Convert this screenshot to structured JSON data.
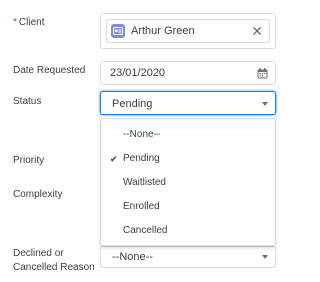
{
  "form": {
    "client": {
      "required_marker": "*",
      "label": "Client",
      "value": "Arthur Green",
      "icon": "contact-card-icon",
      "clear_glyph": "✕"
    },
    "date_requested": {
      "label": "Date Requested",
      "value": "23/01/2020",
      "icon": "calendar-icon"
    },
    "status": {
      "label": "Status",
      "value": "Pending",
      "options": [
        {
          "label": "--None--",
          "selected": false
        },
        {
          "label": "Pending",
          "selected": true
        },
        {
          "label": "Waitlisted",
          "selected": false
        },
        {
          "label": "Enrolled",
          "selected": false
        },
        {
          "label": "Cancelled",
          "selected": false
        }
      ],
      "check_glyph": "✔"
    },
    "priority": {
      "label": "Priority"
    },
    "complexity": {
      "label": "Complexity"
    },
    "declined_reason": {
      "label_line1": "Declined or",
      "label_line2": "Cancelled Reason",
      "value": "--None--"
    }
  },
  "colors": {
    "focus_border": "#1589ee",
    "required": "#c23934",
    "contact_icon_bg": "#7f8de1"
  }
}
